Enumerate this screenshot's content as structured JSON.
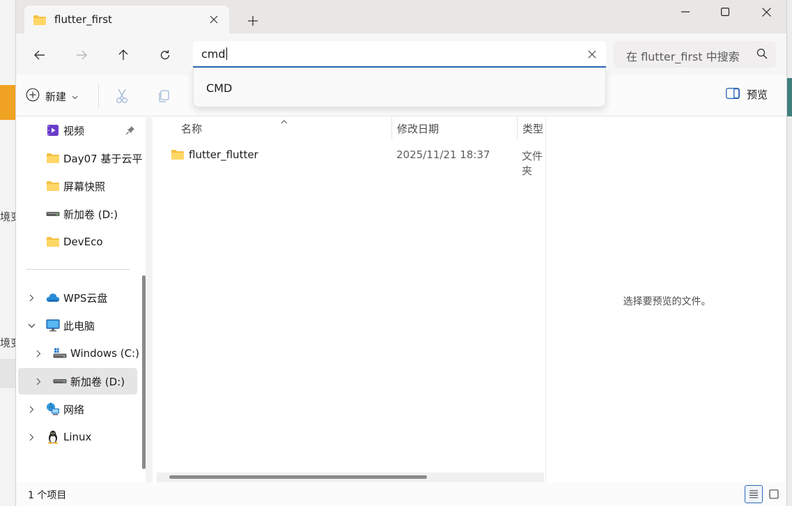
{
  "background_app": {
    "fragment_text_1": "境变",
    "fragment_text_2": "境变"
  },
  "tab": {
    "title": "flutter_first"
  },
  "window_controls": {
    "minimize": "minimize",
    "maximize": "maximize",
    "close": "close"
  },
  "address": {
    "value": "cmd",
    "suggestions": [
      "CMD"
    ]
  },
  "search": {
    "placeholder": "在 flutter_first 中搜索"
  },
  "toolbar": {
    "new_label": "新建",
    "preview_label": "预览"
  },
  "nav": {
    "items": [
      {
        "label": "视频",
        "icon": "video-folder-icon",
        "pinned": true
      },
      {
        "label": "Day07  基于云平",
        "icon": "folder-icon"
      },
      {
        "label": "屏幕快照",
        "icon": "folder-icon"
      },
      {
        "label": "新加卷 (D:)",
        "icon": "drive-icon"
      },
      {
        "label": "DevEco",
        "icon": "folder-icon"
      }
    ],
    "tree": [
      {
        "label": "WPS云盘",
        "icon": "cloud-icon",
        "expanded": false
      },
      {
        "label": "此电脑",
        "icon": "computer-icon",
        "expanded": true
      },
      {
        "label": "Windows (C:)",
        "icon": "windows-drive-icon",
        "expanded": false
      },
      {
        "label": "新加卷 (D:)",
        "icon": "drive-icon",
        "expanded": false,
        "selected": true
      },
      {
        "label": "网络",
        "icon": "network-icon",
        "expanded": false
      },
      {
        "label": "Linux",
        "icon": "linux-icon",
        "expanded": false
      }
    ]
  },
  "columns": {
    "name": "名称",
    "modified": "修改日期",
    "type": "类型"
  },
  "files": [
    {
      "name": "flutter_flutter",
      "modified": "2025/11/21 18:37",
      "type": "文件夹"
    }
  ],
  "preview": {
    "empty_message": "选择要预览的文件。"
  },
  "status": {
    "item_count": "1 个项目"
  },
  "colors": {
    "accent": "#2b67b5",
    "folder": "#f5c042"
  }
}
